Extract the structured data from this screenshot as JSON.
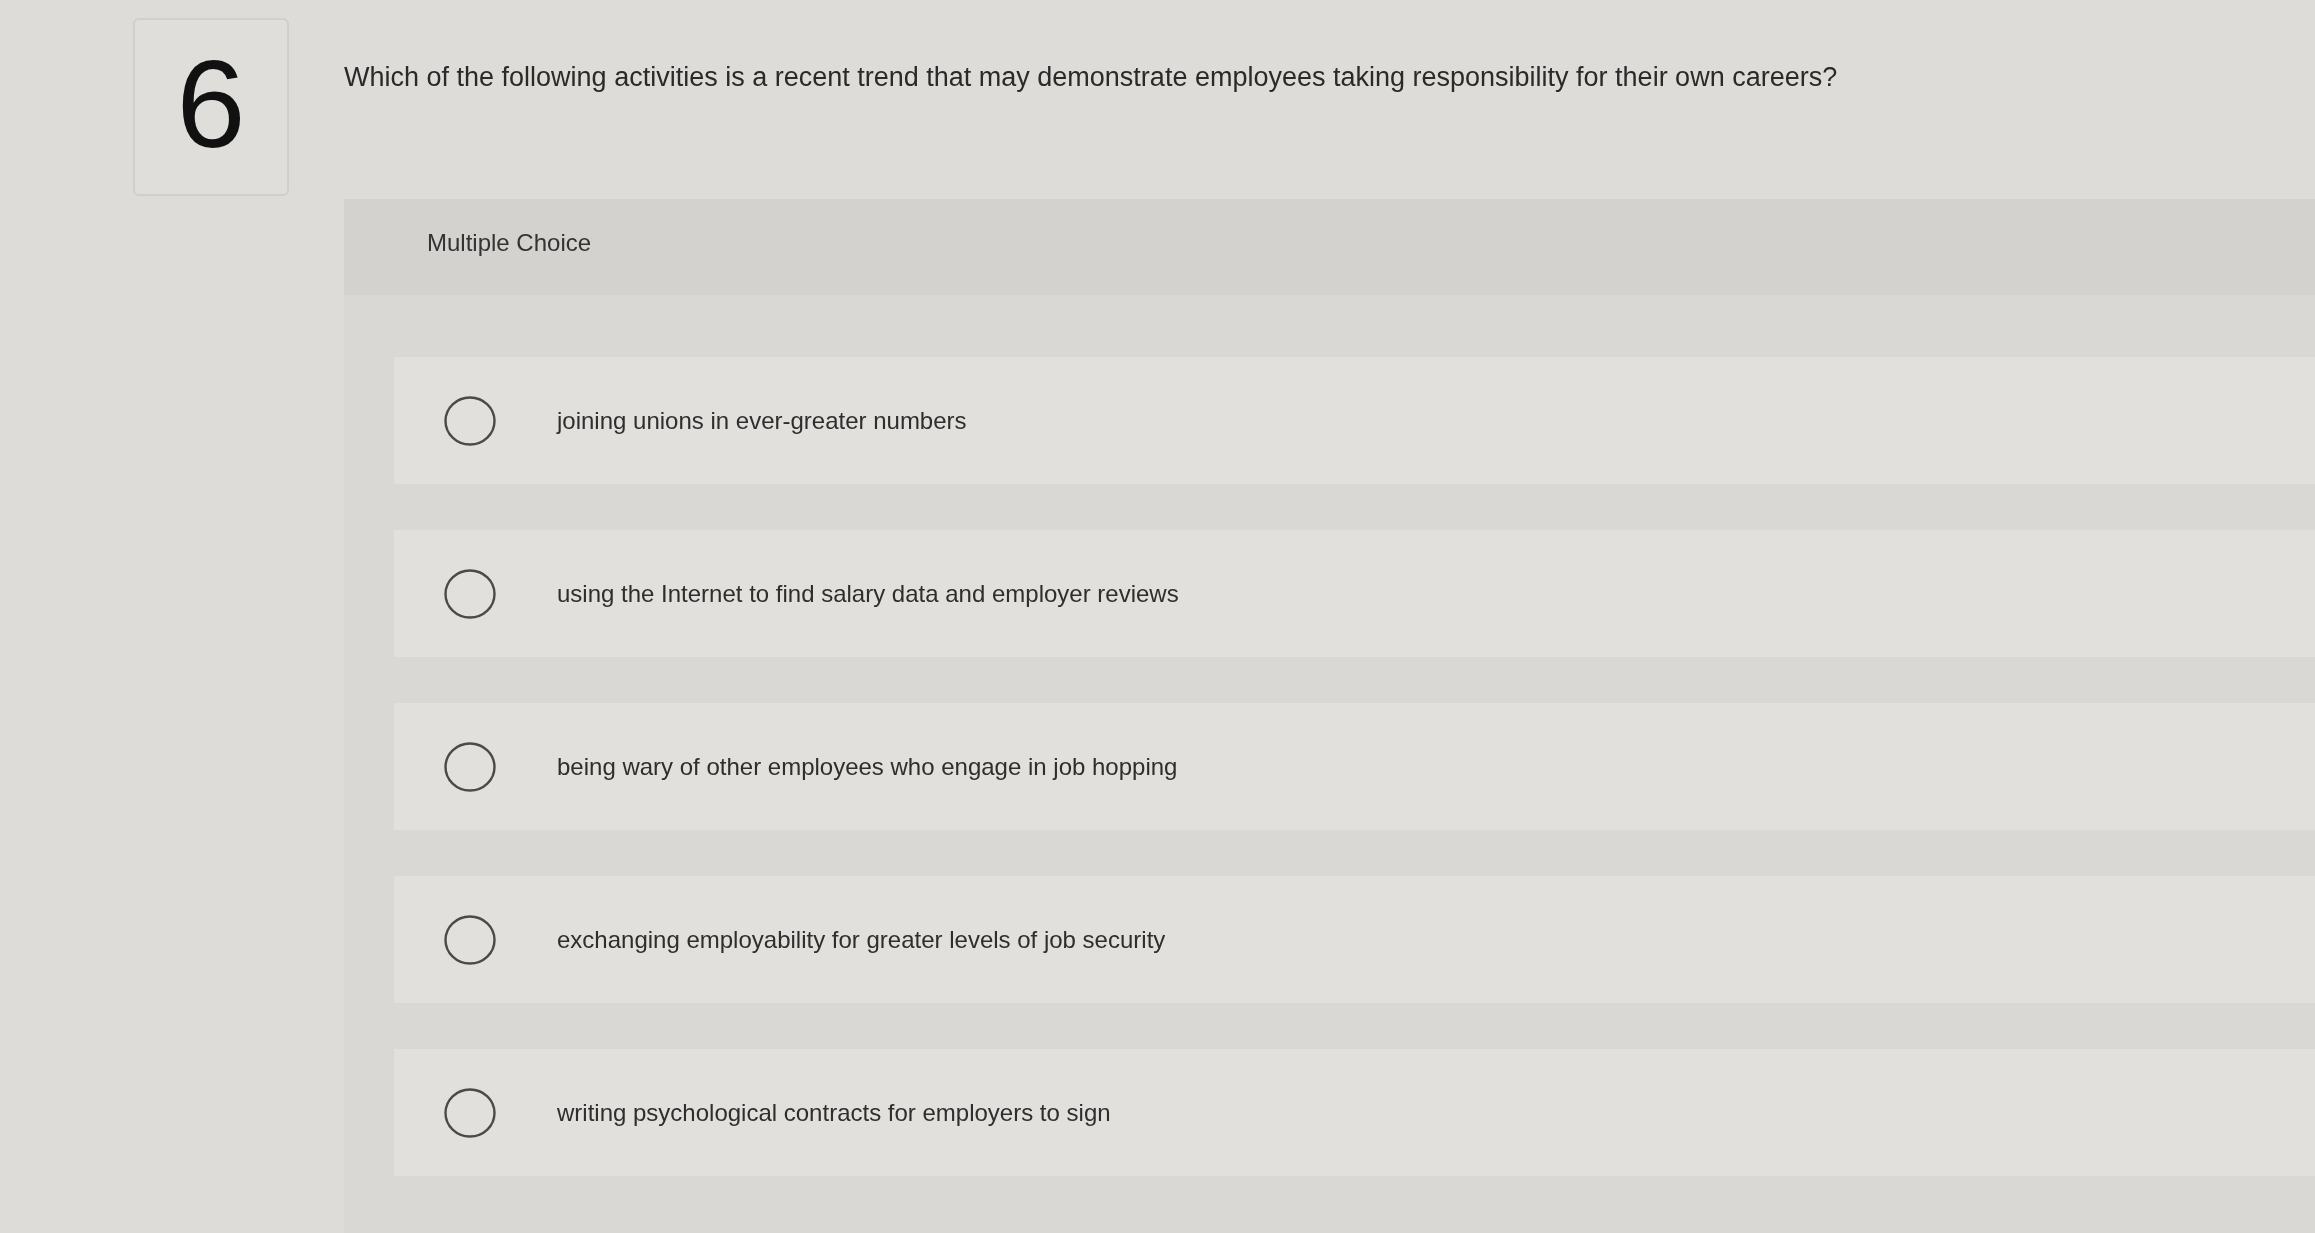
{
  "question": {
    "number": "6",
    "text": "Which of the following activities is a recent trend that may demonstrate employees taking responsibility for their own careers?"
  },
  "answer_panel": {
    "type_label": "Multiple Choice",
    "options": [
      {
        "text": "joining unions in ever-greater numbers",
        "selected": false
      },
      {
        "text": "using the Internet to find salary data and employer reviews",
        "selected": false
      },
      {
        "text": "being wary of other employees who engage in job hopping",
        "selected": false
      },
      {
        "text": "exchanging employability for greater levels of job security",
        "selected": false
      },
      {
        "text": "writing psychological contracts for employers to sign",
        "selected": false
      }
    ]
  }
}
